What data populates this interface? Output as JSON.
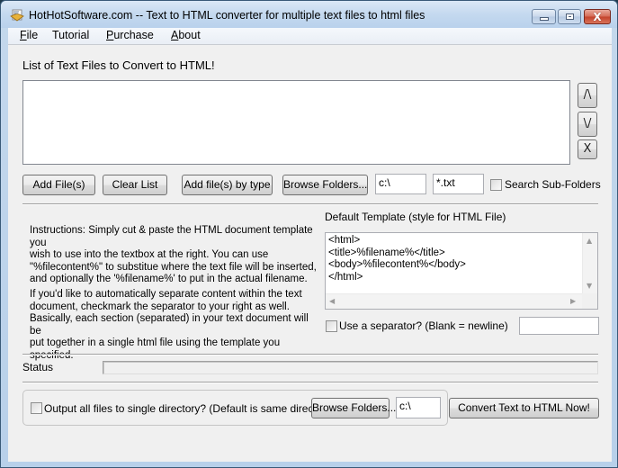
{
  "window": {
    "title": "HotHotSoftware.com -- Text to HTML converter for multiple text files to html files",
    "app_icon": "app-icon",
    "controls": {
      "minimize": "minimize-icon",
      "maximize": "maximize-icon",
      "close": "close-icon",
      "close_glyph": "X"
    }
  },
  "menu": {
    "items": [
      {
        "label": "File",
        "mnemonic": "F",
        "rest": "ile"
      },
      {
        "label": "Tutorial",
        "mnemonic": "",
        "rest": "Tutorial"
      },
      {
        "label": "Purchase",
        "mnemonic": "P",
        "rest": "urchase"
      },
      {
        "label": "About",
        "mnemonic": "A",
        "rest": "bout"
      }
    ]
  },
  "file_list": {
    "heading": "List of Text Files to Convert to HTML!",
    "items": [],
    "move_up_label": "/\\",
    "move_down_label": "\\/",
    "remove_label": "X"
  },
  "toolbar": {
    "add_files": "Add File(s)",
    "clear_list": "Clear List",
    "add_by_type": "Add file(s) by type",
    "browse_folders": "Browse Folders...",
    "folder_path": "c:\\",
    "file_pattern": "*.txt",
    "search_subfolders_label": "Search Sub-Folders",
    "search_subfolders_checked": false
  },
  "instructions": {
    "paragraph1": [
      "Instructions: Simply cut & paste the HTML document template you",
      "wish to use into the textbox at the right. You can use",
      "\"%filecontent%\" to substitue where the text file will be inserted,",
      "and optionally the '%filename%' to put in the actual filename."
    ],
    "paragraph2": [
      "If you'd like to automatically separate content within the text",
      "document, checkmark the separator to your right as well.",
      "Basically, each section (separated) in your text document will be",
      "put together in a single html file using the template you specified."
    ]
  },
  "template": {
    "label": "Default Template (style for HTML File)",
    "content": "<html>\n<title>%filename%</title>\n<body>%filecontent%</body>\n</html>",
    "scroll_up": "▲",
    "scroll_down": "▼",
    "scroll_left": "◀",
    "scroll_right": "▶"
  },
  "separator": {
    "label": "Use a separator? (Blank = newline)",
    "checked": false,
    "value": ""
  },
  "status": {
    "label": "Status",
    "progress": 0
  },
  "output": {
    "single_dir_label": "Output all files to single directory? (Default is same directory)",
    "single_dir_checked": false,
    "browse_folders": "Browse Folders...",
    "output_path": "c:\\",
    "convert_button": "Convert Text to HTML Now!"
  }
}
